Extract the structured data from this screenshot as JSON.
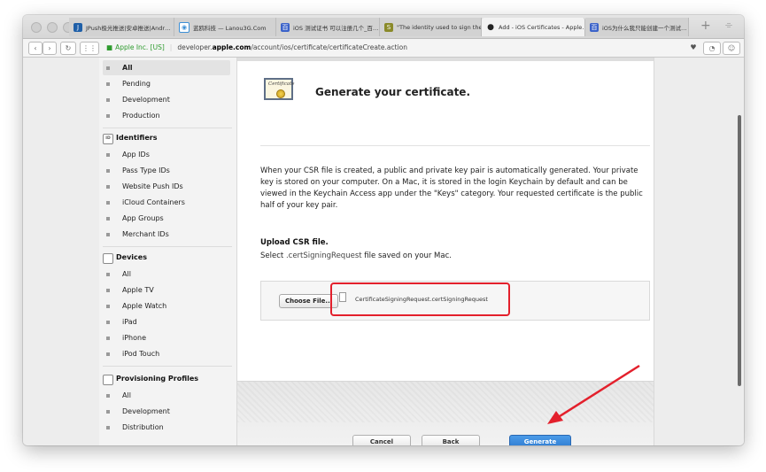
{
  "tabs": [
    {
      "label": "JPush极光推送|安卓推送|Andr…",
      "favicon": "jpush-favicon"
    },
    {
      "label": "蓝鸥科技 — Lanou3G.Com",
      "favicon": "lanou-favicon"
    },
    {
      "label": "iOS 测试证书 可以注册几个_百…",
      "favicon": "baidu-favicon"
    },
    {
      "label": "\"The identity used to sign the…",
      "favicon": "stackoverflow-favicon"
    },
    {
      "label": "Add - iOS Certificates - Apple…",
      "favicon": "apple-favicon"
    },
    {
      "label": "iOS为什么我只能创建一个测试…",
      "favicon": "baidu-favicon"
    }
  ],
  "addressbar": {
    "cert_label": "Apple Inc. [US]",
    "url_prefix": "developer.",
    "url_host": "apple.com",
    "url_path": "/account/ios/certificate/certificateCreate.action"
  },
  "sidebar": {
    "certificates": [
      "All",
      "Pending",
      "Development",
      "Production"
    ],
    "identifiers_heading": "Identifiers",
    "identifiers_icon": "ID",
    "identifiers": [
      "App IDs",
      "Pass Type IDs",
      "Website Push IDs",
      "iCloud Containers",
      "App Groups",
      "Merchant IDs"
    ],
    "devices_heading": "Devices",
    "devices": [
      "All",
      "Apple TV",
      "Apple Watch",
      "iPad",
      "iPhone",
      "iPod Touch"
    ],
    "profiles_heading": "Provisioning Profiles",
    "profiles": [
      "All",
      "Development",
      "Distribution"
    ]
  },
  "main": {
    "cert_icon_text": "Certificate",
    "title": "Generate your certificate.",
    "description": "When your CSR file is created, a public and private key pair is automatically generated. Your private key is stored on your computer. On a Mac, it is stored in the login Keychain by default and can be viewed in the Keychain Access app under the \"Keys\" category. Your requested certificate is the public half of your key pair.",
    "upload_title": "Upload CSR file.",
    "upload_sub_pre": "Select ",
    "upload_sub_ext": ".certSigningRequest",
    "upload_sub_post": " file saved on your Mac.",
    "choose_file_label": "Choose File...",
    "file_name": "CertificateSigningRequest.certSigningRequest"
  },
  "footer": {
    "cancel_label": "Cancel",
    "back_label": "Back",
    "generate_label": "Generate"
  },
  "colors": {
    "accent_blue": "#2d79cf",
    "highlight_red": "#e3202c"
  }
}
